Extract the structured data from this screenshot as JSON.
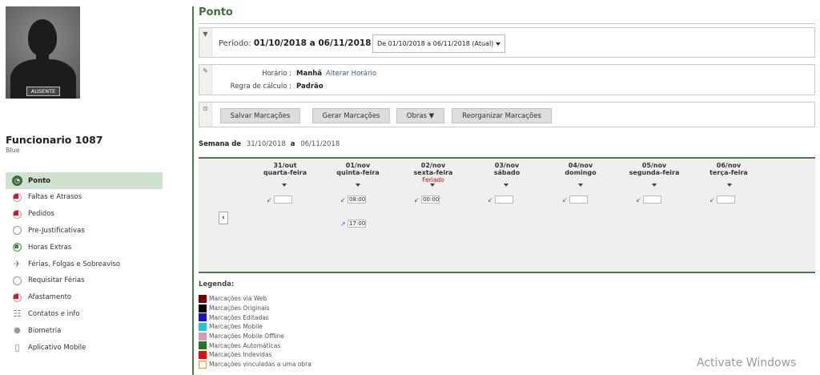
{
  "profile": {
    "status": "AUSENTE",
    "name": "Funcionario 1087",
    "subtitle": "Blue"
  },
  "menu": [
    {
      "label": "Ponto",
      "icon": "clock-icon",
      "active": true
    },
    {
      "label": "Faltas e Atrasos",
      "icon": "clock-alert-icon"
    },
    {
      "label": "Pedidos",
      "icon": "request-icon"
    },
    {
      "label": "Pre-Justificativas",
      "icon": "justify-icon"
    },
    {
      "label": "Horas Extras",
      "icon": "overtime-icon"
    },
    {
      "label": "Férias, Folgas e Sobreaviso",
      "icon": "airplane-icon"
    },
    {
      "label": "Requisitar Férias",
      "icon": "request-vacation-icon"
    },
    {
      "label": "Afastamento",
      "icon": "leave-icon"
    },
    {
      "label": "Contatos e info",
      "icon": "contacts-icon"
    },
    {
      "label": "Biometria",
      "icon": "biometric-icon"
    },
    {
      "label": "Aplicativo Mobile",
      "icon": "mobile-icon"
    }
  ],
  "page": {
    "title": "Ponto"
  },
  "periodo": {
    "label": "Período:",
    "value": "01/10/2018 a 06/11/2018",
    "select": "De 01/10/2018 a 06/11/2018 (Atual)"
  },
  "horario": {
    "label": "Horário :",
    "value": "Manhã",
    "link": "Alterar Horário",
    "regra_label": "Regra de cálculo :",
    "regra_value": "Padrão"
  },
  "actions": {
    "salvar": "Salvar Marcações",
    "gerar": "Gerar Marcações",
    "obras": "Obras ▼",
    "reorganizar": "Reorganizar Marcações"
  },
  "semana": {
    "label": "Semana de",
    "start": "31/10/2018",
    "sep": "a",
    "end": "06/11/2018"
  },
  "days": [
    {
      "date": "31/out",
      "weekday": "quarta-feira",
      "note": "",
      "in": "",
      "out": null
    },
    {
      "date": "01/nov",
      "weekday": "quinta-feira",
      "note": "",
      "in": "08:00",
      "out": "17:00"
    },
    {
      "date": "02/nov",
      "weekday": "sexta-feira",
      "note": "Feriado",
      "in": "00:00",
      "out": null
    },
    {
      "date": "03/nov",
      "weekday": "sábado",
      "note": "",
      "in": "",
      "out": null
    },
    {
      "date": "04/nov",
      "weekday": "domingo",
      "note": "",
      "in": "",
      "out": null
    },
    {
      "date": "05/nov",
      "weekday": "segunda-feira",
      "note": "",
      "in": "",
      "out": null
    },
    {
      "date": "06/nov",
      "weekday": "terça-feira",
      "note": "",
      "in": "",
      "out": null
    }
  ],
  "legend": {
    "title": "Legenda:",
    "items": [
      {
        "label": "Marcações via Web",
        "color": "#7a0000"
      },
      {
        "label": "Marcações Originais",
        "color": "#000000"
      },
      {
        "label": "Marcações Editadas",
        "color": "#1010e0"
      },
      {
        "label": "Marcações Mobile",
        "color": "#1ec8d8"
      },
      {
        "label": "Marcações Mobile Offline",
        "color": "#d69ab4"
      },
      {
        "label": "Marcações Automáticas",
        "color": "#1e7a1e"
      },
      {
        "label": "Marcações Indevidas",
        "color": "#e01010"
      },
      {
        "label": "Marcações vinculadas a uma obra",
        "color": "#ff9900",
        "outline": true
      }
    ]
  },
  "watermark": "Activate Windows"
}
